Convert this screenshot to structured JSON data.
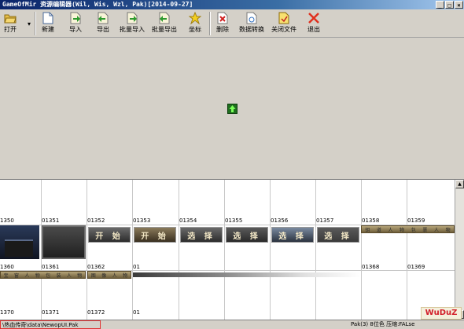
{
  "window": {
    "title": "GameOfMir 资源编辑器(Wil, Wis, Wzl, Pak)[2014-09-27]",
    "buttons": [
      "_",
      "□",
      "×"
    ]
  },
  "toolbar": {
    "items": [
      {
        "label": "打开",
        "icon": "open-folder-icon"
      },
      {
        "label": "新建",
        "icon": "new-file-icon"
      },
      {
        "label": "导入",
        "icon": "import-icon"
      },
      {
        "label": "导出",
        "icon": "export-icon"
      },
      {
        "label": "批量导入",
        "icon": "batch-import-icon"
      },
      {
        "label": "批量导出",
        "icon": "batch-export-icon"
      },
      {
        "label": "坐标",
        "icon": "star-icon"
      },
      {
        "label": "删除",
        "icon": "delete-icon"
      },
      {
        "label": "数据转换",
        "icon": "convert-icon"
      },
      {
        "label": "关闭文件",
        "icon": "close-file-icon"
      },
      {
        "label": "退出",
        "icon": "exit-icon"
      }
    ]
  },
  "grid": {
    "row1_labels": [
      "1350",
      "01351",
      "01352",
      "01353",
      "01354",
      "01355",
      "01356",
      "01357",
      "01358",
      "01359"
    ],
    "row2_labels": [
      "1360",
      "01361",
      "01362",
      "01",
      "01368",
      "01369"
    ],
    "row3_labels": [
      "1370",
      "01371",
      "01372",
      "01"
    ],
    "buttons": [
      "开 始",
      "开 始",
      "选 择",
      "选 择",
      "选 择",
      "选 择"
    ],
    "ribbon1": [
      "钥",
      "道",
      "人",
      "物",
      "包",
      "裹",
      "人",
      "物"
    ],
    "ribbon2": [
      "宝",
      "窗",
      "人",
      "物",
      "包",
      "装",
      "人",
      "物"
    ],
    "ribbon3": [
      "图",
      "像",
      "人",
      "物"
    ]
  },
  "statusbar": {
    "path": "\\热血传奇\\data\\NewopUI.Pak",
    "info": "Pak(3) 8位色 压缩:FALse"
  },
  "watermark": {
    "text": "WuDuZ"
  },
  "colors": {
    "title_start": "#0a246a",
    "title_end": "#a6caf0",
    "highlight_border": "#e03030",
    "watermark_text": "#d21f2a"
  }
}
